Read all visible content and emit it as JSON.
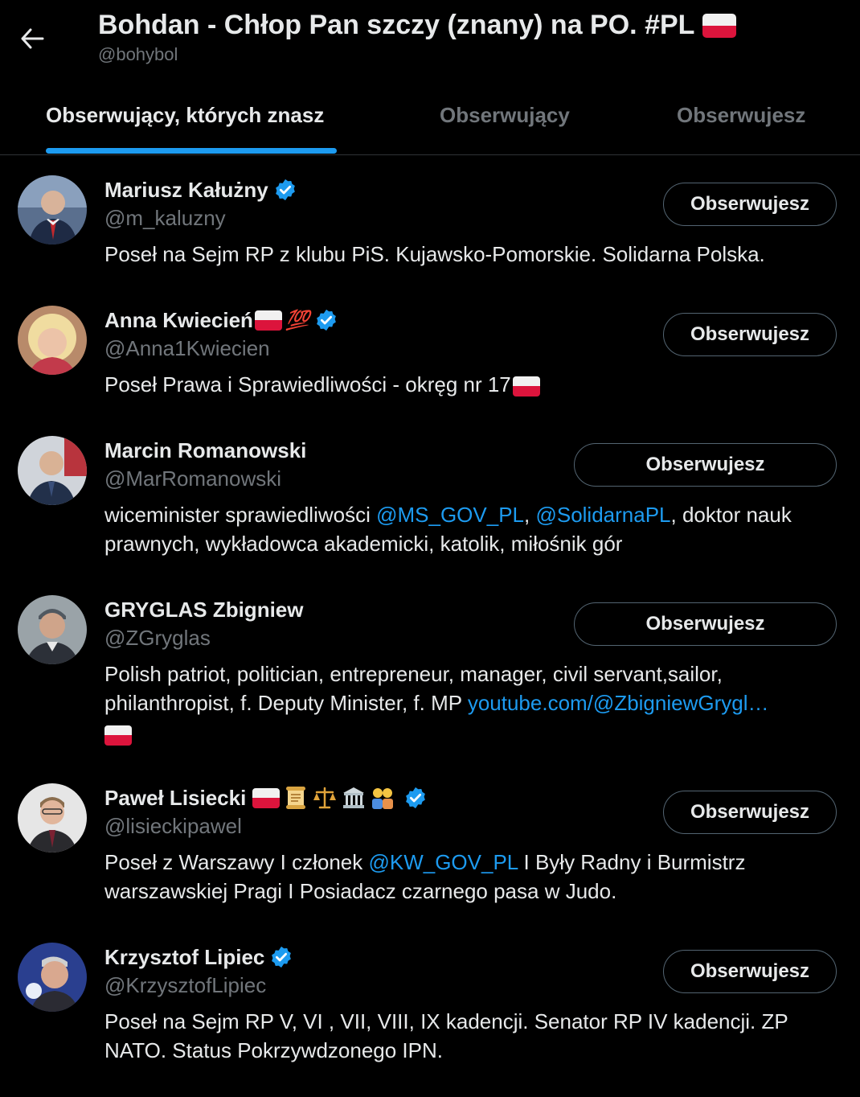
{
  "header": {
    "title": "Bohdan - Chłop Pan szczy (znany) na PO. #PL",
    "handle": "@bohybol"
  },
  "tabs": [
    {
      "label": "Obserwujący, których znasz",
      "active": true
    },
    {
      "label": "Obserwujący",
      "active": false
    },
    {
      "label": "Obserwujesz",
      "active": false
    }
  ],
  "colors": {
    "accent": "#1d9bf0",
    "background": "#000000",
    "muted": "#71767b",
    "flag_red": "#dc143c"
  },
  "users": [
    {
      "name": "Mariusz Kałużny",
      "handle": "@m_kaluzny",
      "bio": "Poseł na Sejm RP z klubu PiS. Kujawsko-Pomorskie. Solidarna Polska.",
      "button": "Obserwujesz"
    },
    {
      "name": "Anna Kwiecień",
      "name_suffix": "💯",
      "handle": "@Anna1Kwiecien",
      "bio": "Poseł Prawa i Sprawiedliwości - okręg nr 17",
      "button": "Obserwujesz"
    },
    {
      "name": "Marcin Romanowski",
      "handle": "@MarRomanowski",
      "bio_part1": "wiceminister sprawiedliwości ",
      "bio_link1": "@MS_GOV_PL",
      "bio_part2": ", ",
      "bio_link2": "@SolidarnaPL",
      "bio_part3": ", doktor nauk prawnych, wykładowca akademicki, katolik, miłośnik gór",
      "button": "Obserwujesz"
    },
    {
      "name": "GRYGLAS Zbigniew",
      "handle": "@ZGryglas",
      "bio_part1": "Polish patriot, politician, entrepreneur, manager, civil servant,sailor, philanthropist, f. Deputy Minister, f. MP ",
      "bio_link1": "youtube.com/@ZbigniewGrygl…",
      "button": "Obserwujesz"
    },
    {
      "name": "Paweł Lisiecki",
      "name_emojis": "📜⚖️🏛️👫",
      "handle": "@lisieckipawel",
      "bio_part1": "Poseł z Warszawy I członek ",
      "bio_link1": "@KW_GOV_PL",
      "bio_part2": " I Były Radny i Burmistrz warszawskiej Pragi I Posiadacz czarnego pasa w Judo.",
      "button": "Obserwujesz"
    },
    {
      "name": "Krzysztof Lipiec",
      "handle": "@KrzysztofLipiec",
      "bio": "Poseł na Sejm RP V, VI , VII, VIII, IX kadencji. Senator RP IV kadencji. ZP NATO. Status Pokrzywdzonego IPN.",
      "button": "Obserwujesz"
    }
  ]
}
